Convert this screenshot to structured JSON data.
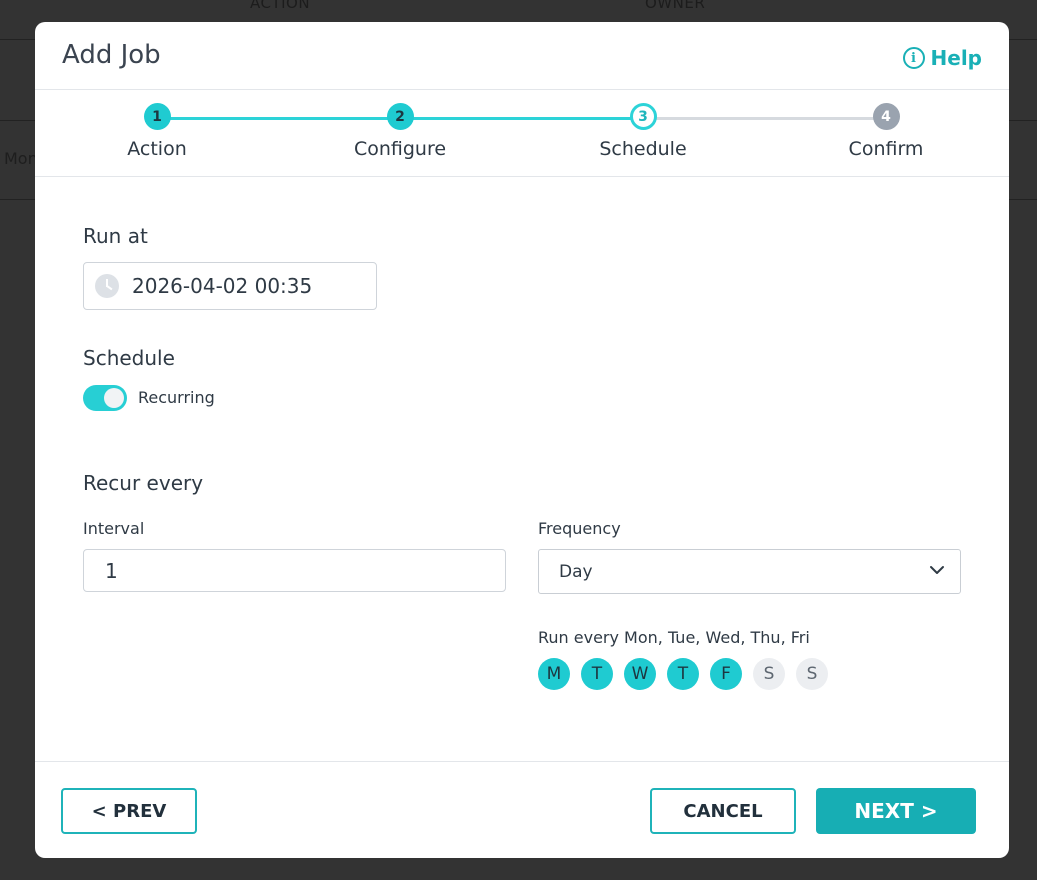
{
  "background": {
    "columns": [
      "ACTION",
      "OWNER"
    ],
    "row_cell": "Mon"
  },
  "modal": {
    "title": "Add Job",
    "help_label": "Help",
    "steps": [
      {
        "number": "1",
        "label": "Action",
        "state": "done"
      },
      {
        "number": "2",
        "label": "Configure",
        "state": "done"
      },
      {
        "number": "3",
        "label": "Schedule",
        "state": "current"
      },
      {
        "number": "4",
        "label": "Confirm",
        "state": "future"
      }
    ],
    "run_at": {
      "label": "Run at",
      "value": "2026-04-02 00:35"
    },
    "schedule": {
      "label": "Schedule",
      "toggle_label": "Recurring",
      "toggle_on": true
    },
    "recur": {
      "label": "Recur every",
      "interval_label": "Interval",
      "interval_value": "1",
      "frequency_label": "Frequency",
      "frequency_value": "Day",
      "run_every_text": "Run every Mon, Tue, Wed, Thu, Fri",
      "days": [
        {
          "letter": "M",
          "selected": true
        },
        {
          "letter": "T",
          "selected": true
        },
        {
          "letter": "W",
          "selected": true
        },
        {
          "letter": "T",
          "selected": true
        },
        {
          "letter": "F",
          "selected": true
        },
        {
          "letter": "S",
          "selected": false
        },
        {
          "letter": "S",
          "selected": false
        }
      ]
    },
    "footer": {
      "prev_label": "< PREV",
      "cancel_label": "CANCEL",
      "next_label": "NEXT >"
    }
  },
  "colors": {
    "accent": "#1fcbd1",
    "primary_button": "#17aeb4",
    "future_step": "#9aa3af"
  }
}
